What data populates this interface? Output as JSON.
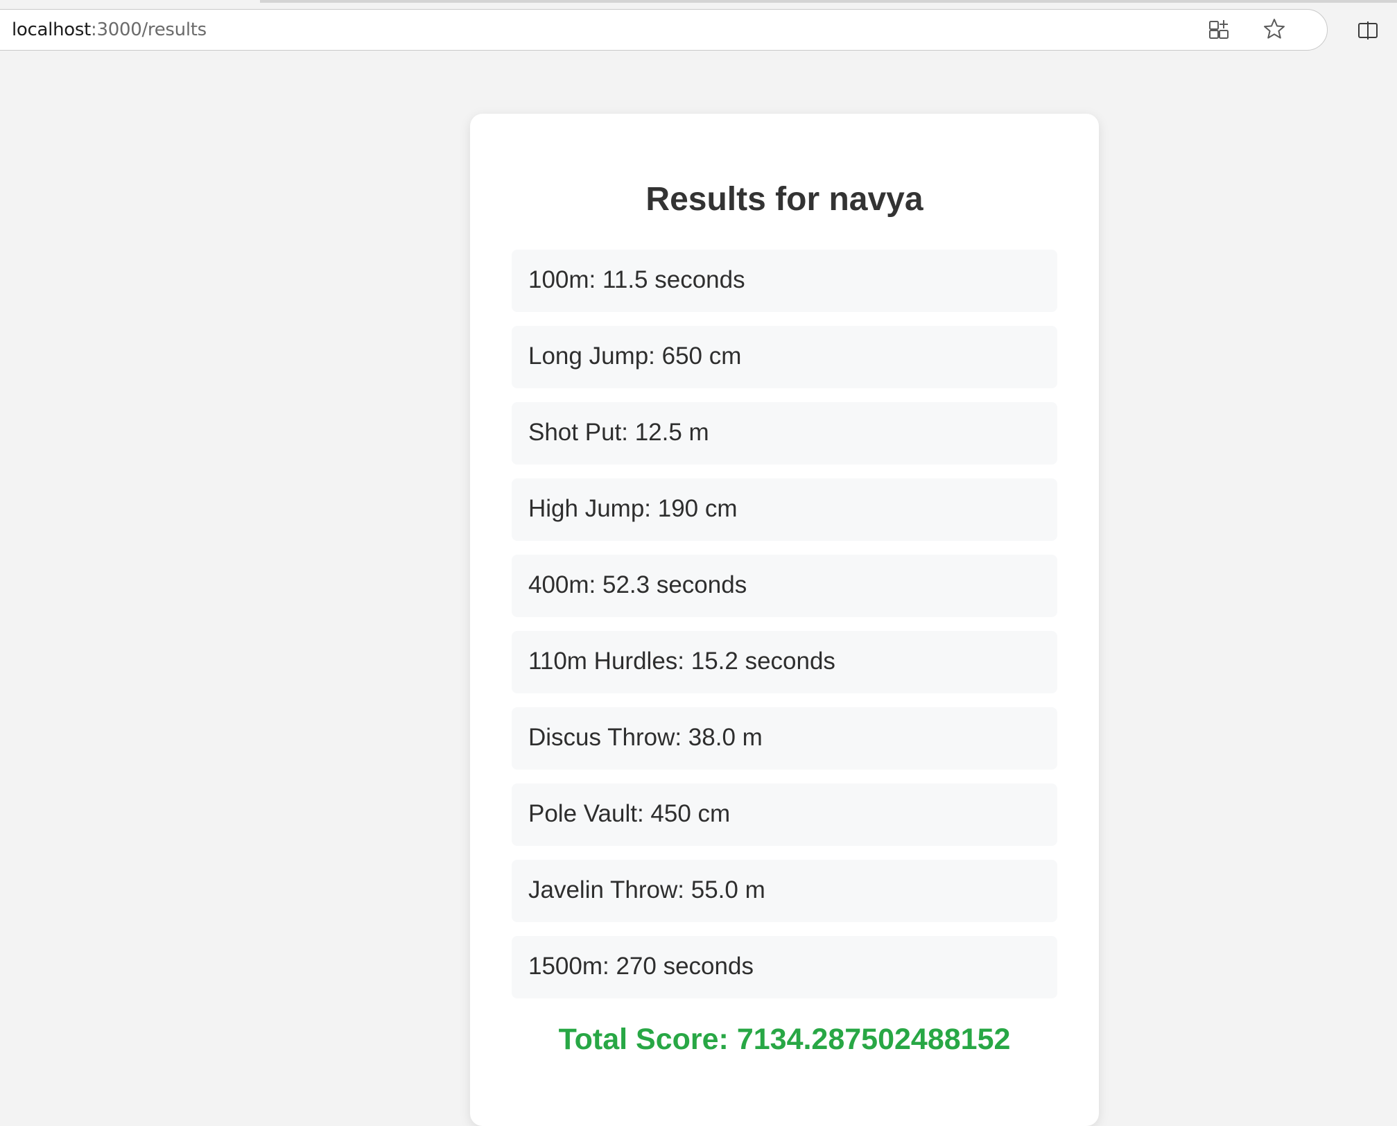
{
  "browser": {
    "url_host": "localhost",
    "url_path": ":3000/results"
  },
  "page": {
    "title": "Results for navya",
    "results": [
      {
        "label": "100m: 11.5 seconds"
      },
      {
        "label": "Long Jump: 650 cm"
      },
      {
        "label": "Shot Put: 12.5 m"
      },
      {
        "label": "High Jump: 190 cm"
      },
      {
        "label": "400m: 52.3 seconds"
      },
      {
        "label": "110m Hurdles: 15.2 seconds"
      },
      {
        "label": "Discus Throw: 38.0 m"
      },
      {
        "label": "Pole Vault: 450 cm"
      },
      {
        "label": "Javelin Throw: 55.0 m"
      },
      {
        "label": "1500m: 270 seconds"
      }
    ],
    "total_score": "Total Score: 7134.287502488152"
  },
  "icons": {
    "app_icon": "add-app-icon",
    "favorite_icon": "star-icon",
    "split_icon": "split-screen-icon"
  },
  "colors": {
    "total_score": "#28a745",
    "page_background": "#f3f3f3",
    "card_background": "#ffffff",
    "item_background": "#f7f8f9"
  }
}
